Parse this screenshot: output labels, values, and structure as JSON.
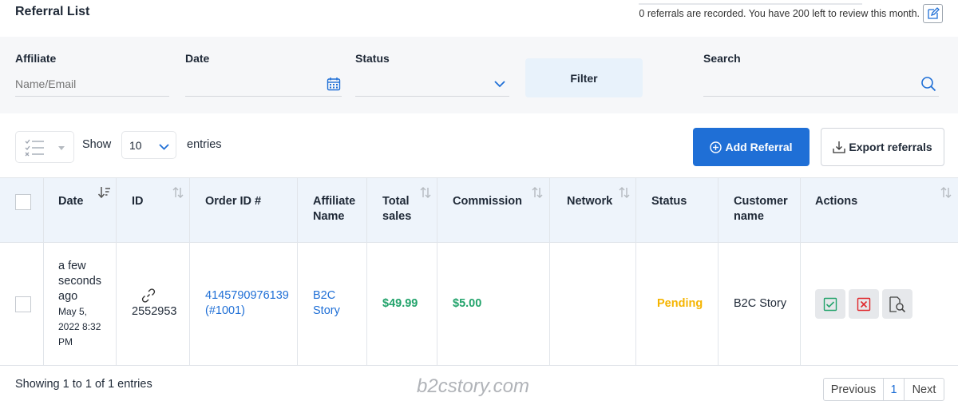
{
  "header": {
    "title": "Referral List",
    "notice": "0 referrals are recorded. You have 200 left to review this month."
  },
  "filters": {
    "affiliate_label": "Affiliate",
    "affiliate_placeholder": "Name/Email",
    "date_label": "Date",
    "status_label": "Status",
    "filter_button": "Filter",
    "search_label": "Search"
  },
  "toolbar": {
    "show_label": "Show",
    "page_length": "10",
    "entries_label": "entries",
    "add_button": "Add Referral",
    "export_button": "Export referrals"
  },
  "table": {
    "columns": {
      "date": "Date",
      "id": "ID",
      "order_id": "Order ID #",
      "affiliate_name": "Affiliate Name",
      "total_sales": "Total sales",
      "commission": "Commission",
      "network": "Network",
      "status": "Status",
      "customer_name": "Customer name",
      "actions": "Actions"
    },
    "rows": [
      {
        "date_relative": "a few seconds ago",
        "date_full": "May 5, 2022 8:32 PM",
        "id": "2552953",
        "order_id": "4145790976139 (#1001)",
        "affiliate_name": "B2C Story",
        "total_sales": "$49.99",
        "commission": "$5.00",
        "network": "",
        "status": "Pending",
        "customer_name": "B2C Story"
      }
    ]
  },
  "footer": {
    "info": "Showing 1 to 1 of 1 entries",
    "watermark": "b2cstory.com",
    "prev": "Previous",
    "page": "1",
    "next": "Next"
  },
  "colors": {
    "primary": "#1f6fd6",
    "money": "#22a36b",
    "pending": "#f5b400",
    "header_bg": "#eef4fb"
  }
}
